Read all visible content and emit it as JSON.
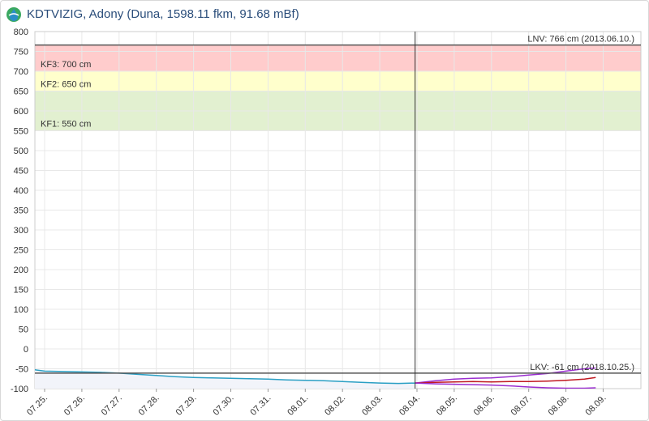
{
  "title": "KDTVIZIG, Adony (Duna, 1598.11 fkm, 91.68 mBf)",
  "logo_icon": "water-drop-logo-icon",
  "colors": {
    "title": "#2a4d7a",
    "band_kf3": "#ffcccc",
    "band_kf2": "#ffffcc",
    "band_kf1": "#e2f0d0",
    "observed": "#2a9fc4",
    "observed_fill": "#f2f4fa",
    "forecast_red": "#c01820",
    "forecast_purple": "#9a2ed0",
    "reference_line": "#555555",
    "grid": "#e8e8e8"
  },
  "chart_data": {
    "type": "line",
    "ylim": [
      -100,
      800
    ],
    "yticks": [
      "800",
      "750",
      "700",
      "650",
      "600",
      "550",
      "500",
      "450",
      "400",
      "350",
      "300",
      "250",
      "200",
      "150",
      "100",
      "50",
      "0",
      "-50",
      "-100"
    ],
    "xticks": [
      "07.25.",
      "07.26.",
      "07.27.",
      "07.28.",
      "07.29.",
      "07.30.",
      "07.31.",
      "08.01.",
      "08.02.",
      "08.03.",
      "08.04.",
      "08.05.",
      "08.06.",
      "08.07.",
      "08.08.",
      "08.09."
    ],
    "xrange": [
      0,
      15.33
    ],
    "current_time_x": 9.95,
    "bands": [
      {
        "label": "KF3: 700 cm",
        "from": 700,
        "to": 766,
        "color_key": "band_kf3"
      },
      {
        "label": "KF2: 650 cm",
        "from": 650,
        "to": 700,
        "color_key": "band_kf2"
      },
      {
        "label": "KF1: 550 cm",
        "from": 550,
        "to": 650,
        "color_key": "band_kf1"
      }
    ],
    "reference_lines": [
      {
        "label": "LNV: 766 cm (2013.06.10.)",
        "value": 766
      },
      {
        "label": "LKV: -61 cm (2018.10.25.)",
        "value": -61
      }
    ],
    "series": [
      {
        "color_key": "observed",
        "filled": true,
        "points": [
          [
            -0.3,
            -52
          ],
          [
            0,
            -56
          ],
          [
            0.5,
            -57
          ],
          [
            1,
            -58
          ],
          [
            1.5,
            -59
          ],
          [
            2,
            -61
          ],
          [
            2.5,
            -64
          ],
          [
            3,
            -67
          ],
          [
            3.5,
            -70
          ],
          [
            4,
            -72
          ],
          [
            4.5,
            -73
          ],
          [
            5,
            -74
          ],
          [
            5.5,
            -75
          ],
          [
            6,
            -76
          ],
          [
            6.5,
            -78
          ],
          [
            7,
            -79
          ],
          [
            7.5,
            -80
          ],
          [
            8,
            -82
          ],
          [
            8.5,
            -84
          ],
          [
            9,
            -86
          ],
          [
            9.5,
            -87
          ],
          [
            9.95,
            -86
          ]
        ]
      },
      {
        "color_key": "forecast_purple",
        "points": [
          [
            9.95,
            -86
          ],
          [
            10.5,
            -80
          ],
          [
            11,
            -76
          ],
          [
            11.5,
            -74
          ],
          [
            12,
            -73
          ],
          [
            12.5,
            -70
          ],
          [
            13,
            -66
          ],
          [
            13.5,
            -62
          ],
          [
            14,
            -56
          ],
          [
            14.5,
            -50
          ],
          [
            14.8,
            -48
          ]
        ]
      },
      {
        "color_key": "forecast_red",
        "points": [
          [
            9.95,
            -86
          ],
          [
            10.5,
            -84
          ],
          [
            11,
            -83
          ],
          [
            11.5,
            -82
          ],
          [
            12,
            -83
          ],
          [
            12.5,
            -82
          ],
          [
            13,
            -82
          ],
          [
            13.5,
            -81
          ],
          [
            14,
            -79
          ],
          [
            14.5,
            -76
          ],
          [
            14.8,
            -72
          ]
        ]
      },
      {
        "color_key": "forecast_purple",
        "points": [
          [
            9.95,
            -86
          ],
          [
            10.5,
            -88
          ],
          [
            11,
            -89
          ],
          [
            11.5,
            -90
          ],
          [
            12,
            -91
          ],
          [
            12.5,
            -93
          ],
          [
            13,
            -96
          ],
          [
            13.5,
            -98
          ],
          [
            14,
            -99
          ],
          [
            14.5,
            -99
          ],
          [
            14.8,
            -98
          ]
        ]
      }
    ]
  }
}
